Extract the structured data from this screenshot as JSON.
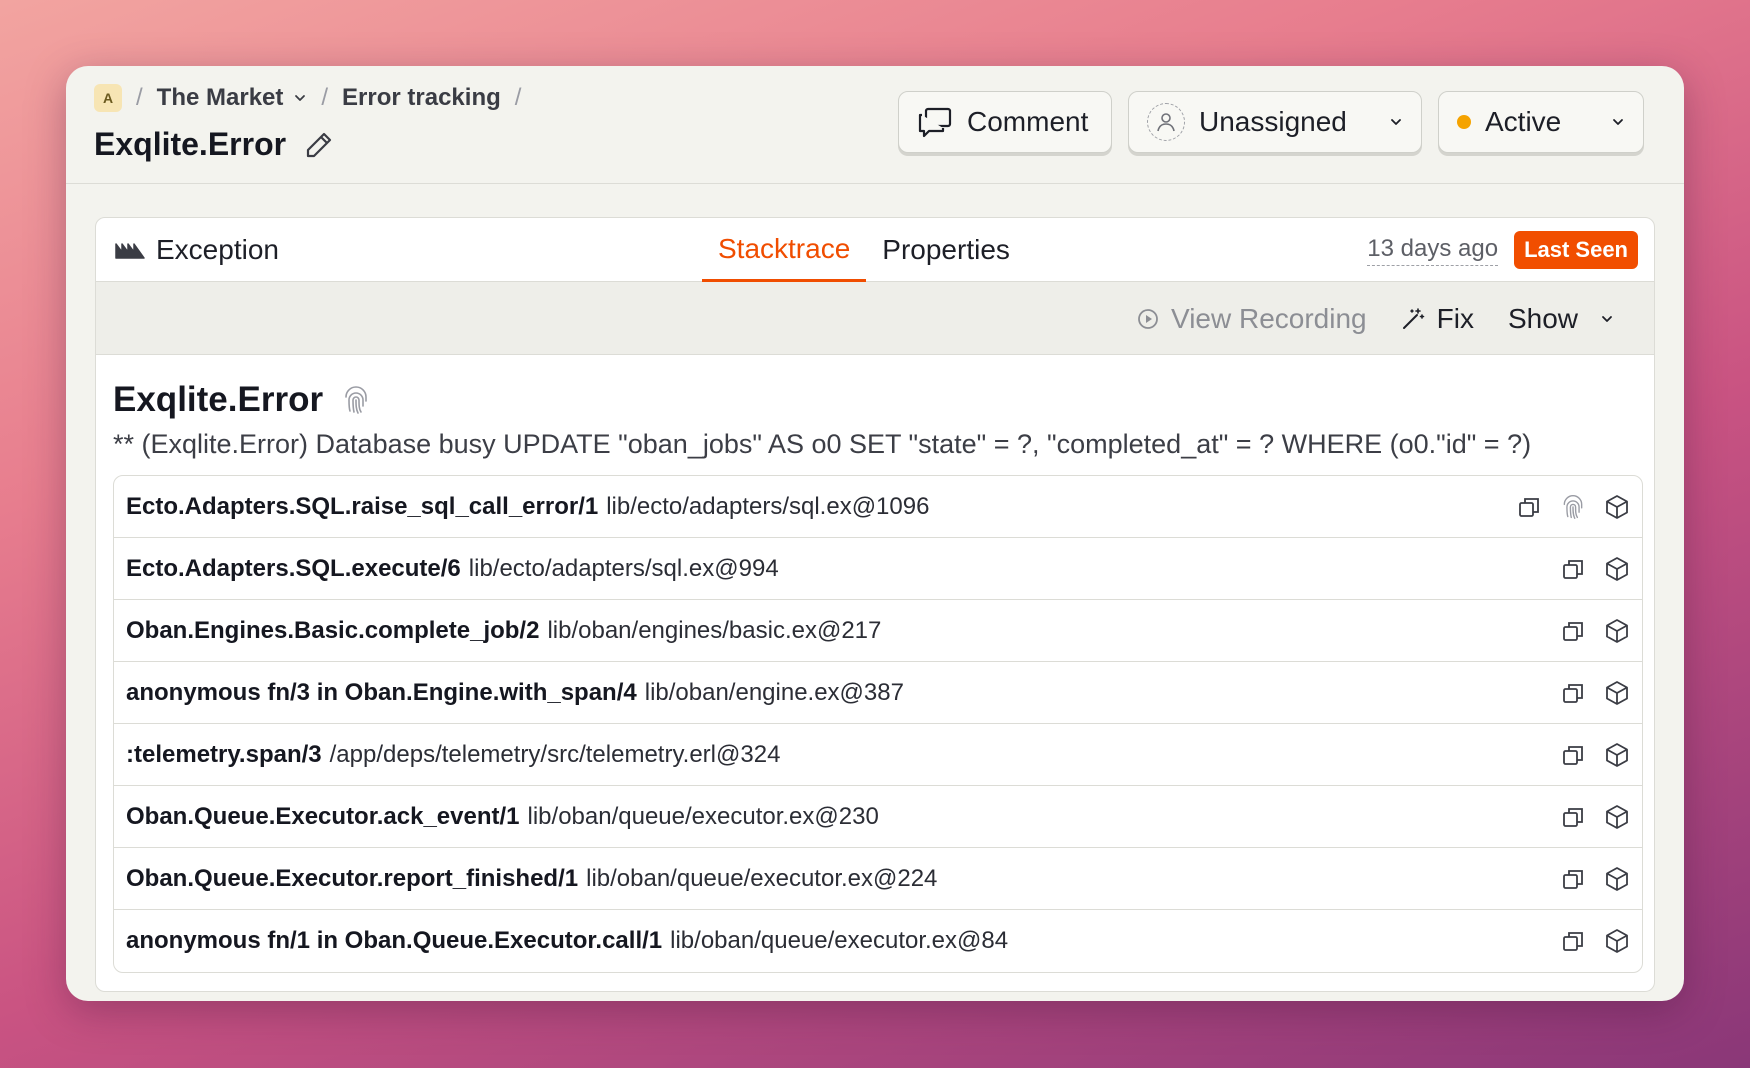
{
  "breadcrumb": {
    "project_initial": "A",
    "project": "The Market",
    "section": "Error tracking",
    "separator": "/"
  },
  "page": {
    "title": "Exqlite.Error"
  },
  "actions": {
    "comment": "Comment",
    "assignee": "Unassigned",
    "status": "Active",
    "status_color": "#f5a300"
  },
  "panel": {
    "type_label": "Exception",
    "tabs": [
      "Stacktrace",
      "Properties"
    ],
    "active_tab": "Stacktrace",
    "last_seen_time": "13 days ago",
    "last_seen_badge": "Last Seen",
    "toolbar": {
      "view_recording": "View Recording",
      "fix": "Fix",
      "show": "Show"
    }
  },
  "exception": {
    "title": "Exqlite.Error",
    "message": "** (Exqlite.Error) Database busy UPDATE \"oban_jobs\" AS o0 SET \"state\" = ?, \"completed_at\" = ? WHERE (o0.\"id\" = ?)"
  },
  "frames": [
    {
      "fn": "Ecto.Adapters.SQL.raise_sql_call_error/1",
      "path": "lib/ecto/adapters/sql.ex@1096",
      "fingerprint": true
    },
    {
      "fn": "Ecto.Adapters.SQL.execute/6",
      "path": "lib/ecto/adapters/sql.ex@994",
      "fingerprint": false
    },
    {
      "fn": "Oban.Engines.Basic.complete_job/2",
      "path": "lib/oban/engines/basic.ex@217",
      "fingerprint": false
    },
    {
      "fn": "anonymous fn/3 in Oban.Engine.with_span/4",
      "path": "lib/oban/engine.ex@387",
      "fingerprint": false
    },
    {
      "fn": ":telemetry.span/3",
      "path": "/app/deps/telemetry/src/telemetry.erl@324",
      "fingerprint": false
    },
    {
      "fn": "Oban.Queue.Executor.ack_event/1",
      "path": "lib/oban/queue/executor.ex@230",
      "fingerprint": false
    },
    {
      "fn": "Oban.Queue.Executor.report_finished/1",
      "path": "lib/oban/queue/executor.ex@224",
      "fingerprint": false
    },
    {
      "fn": "anonymous fn/1 in Oban.Queue.Executor.call/1",
      "path": "lib/oban/queue/executor.ex@84",
      "fingerprint": false
    }
  ],
  "colors": {
    "accent": "#f04d00",
    "badge": "#f14e00"
  },
  "icons": [
    "chevron-down-icon",
    "pencil-icon",
    "comment-icon",
    "person-icon",
    "exception-icon",
    "play-circle-icon",
    "magic-wand-icon",
    "fingerprint-icon",
    "copy-icon",
    "package-icon"
  ]
}
